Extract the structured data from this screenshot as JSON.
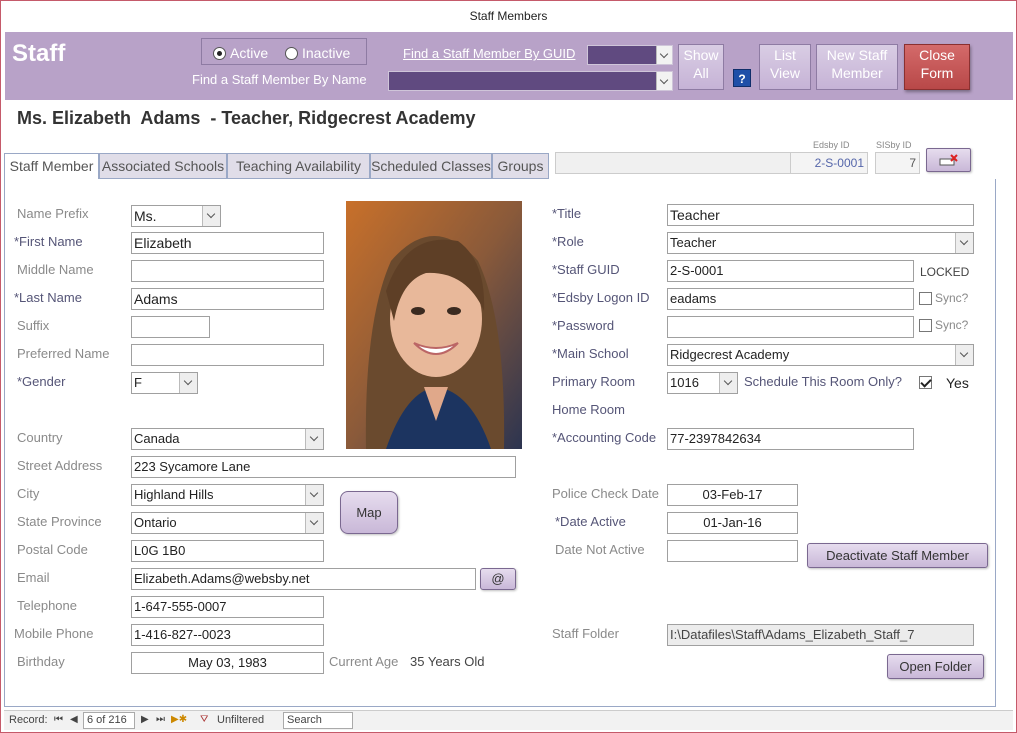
{
  "window": {
    "title": "Staff Members"
  },
  "header": {
    "title": "Staff",
    "radio_active": "Active",
    "radio_inactive": "Inactive",
    "find_by_guid": "Find a Staff Member By GUID",
    "find_by_name": "Find a Staff Member By Name",
    "show_all": [
      "Show",
      "All"
    ],
    "help": "?",
    "list_view": [
      "List",
      "View"
    ],
    "new_staff": [
      "New Staff",
      "Member"
    ],
    "close_form": [
      "Close",
      "Form"
    ]
  },
  "heading": "Ms. Elizabeth  Adams  - Teacher, Ridgecrest Academy",
  "tabs": [
    "Staff Member",
    "Associated Schools",
    "Teaching Availability",
    "Scheduled Classes",
    "Groups"
  ],
  "ids": {
    "edsby_label": "Edsby ID",
    "edsby_value": "2-S-0001",
    "sisby_label": "SISby ID",
    "sisby_value": "7"
  },
  "form": {
    "name_prefix": {
      "label": "Name Prefix",
      "value": "Ms."
    },
    "first_name": {
      "label": "*First Name",
      "value": "Elizabeth"
    },
    "middle_name": {
      "label": "Middle Name",
      "value": ""
    },
    "last_name": {
      "label": "*Last Name",
      "value": "Adams"
    },
    "suffix": {
      "label": "Suffix",
      "value": ""
    },
    "preferred_name": {
      "label": "Preferred Name",
      "value": ""
    },
    "gender": {
      "label": "*Gender",
      "value": "F"
    },
    "country": {
      "label": "Country",
      "value": "Canada"
    },
    "street": {
      "label": "Street Address",
      "value": "223 Sycamore Lane"
    },
    "city": {
      "label": "City",
      "value": "Highland Hills"
    },
    "state": {
      "label": "State Province",
      "value": "Ontario"
    },
    "postal": {
      "label": "Postal Code",
      "value": "L0G 1B0"
    },
    "email": {
      "label": "Email",
      "value": "Elizabeth.Adams@websby.net",
      "button": "@"
    },
    "telephone": {
      "label": "Telephone",
      "value": "1-647-555-0007"
    },
    "mobile": {
      "label": "Mobile Phone",
      "value": "1-416-827--0023"
    },
    "birthday": {
      "label": "Birthday",
      "value": "May 03, 1983"
    },
    "current_age": {
      "label": "Current Age",
      "value": "35 Years Old"
    },
    "map_button": "Map",
    "title": {
      "label": "*Title",
      "value": "Teacher"
    },
    "role": {
      "label": "*Role",
      "value": "Teacher"
    },
    "staff_guid": {
      "label": "*Staff GUID",
      "value": "2-S-0001",
      "status": "LOCKED"
    },
    "edsby_logon": {
      "label": "*Edsby Logon ID",
      "value": "eadams",
      "sync": "Sync?"
    },
    "password": {
      "label": "*Password",
      "value": "",
      "sync": "Sync?"
    },
    "main_school": {
      "label": "*Main School",
      "value": "Ridgecrest Academy"
    },
    "primary_room": {
      "label": "Primary Room",
      "value": "1016",
      "schedule_label": "Schedule This Room Only?",
      "schedule_value": "Yes"
    },
    "home_room": {
      "label": "Home Room"
    },
    "accounting_code": {
      "label": "*Accounting Code",
      "value": "77-2397842634"
    },
    "police_check": {
      "label": "Police Check Date",
      "value": "03-Feb-17"
    },
    "date_active": {
      "label": "*Date Active",
      "value": "01-Jan-16"
    },
    "date_not_active": {
      "label": "Date Not Active",
      "value": ""
    },
    "deactivate_button": "Deactivate Staff Member",
    "staff_folder": {
      "label": "Staff Folder",
      "value": "I:\\Datafiles\\Staff\\Adams_Elizabeth_Staff_7"
    },
    "open_folder_button": "Open Folder"
  },
  "statusbar": {
    "record_label": "Record:",
    "position": "6 of 216",
    "filter": "Unfiltered",
    "search": "Search"
  }
}
